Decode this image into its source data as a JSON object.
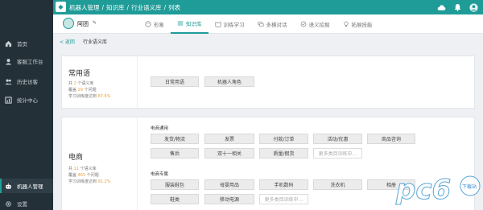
{
  "topbar": {
    "logo_glyph": "◆",
    "breadcrumb": [
      "机器人管理",
      "知识库",
      "行业语义库",
      "列表"
    ]
  },
  "sidebar": {
    "items": [
      {
        "label": "首页",
        "icon": "home-icon"
      },
      {
        "label": "客服工作台",
        "icon": "agent-icon"
      },
      {
        "label": "历史访客",
        "icon": "users-icon"
      },
      {
        "label": "统计中心",
        "icon": "chart-icon"
      },
      {
        "label": "机器人管理",
        "icon": "robot-icon"
      },
      {
        "label": "设置",
        "icon": "gear-icon"
      }
    ]
  },
  "header": {
    "robot_name": "阿团",
    "tabs": [
      {
        "label": "形象",
        "icon": "face-icon"
      },
      {
        "label": "知识库",
        "icon": "book-icon"
      },
      {
        "label": "训练学习",
        "icon": "study-icon"
      },
      {
        "label": "多横对话",
        "icon": "dialog-icon"
      },
      {
        "label": "语义挖掘",
        "icon": "mining-icon"
      },
      {
        "label": "拓展技能",
        "icon": "skill-icon"
      }
    ]
  },
  "backrow": {
    "back_label": "< 返回",
    "title": "行业语义库"
  },
  "card1": {
    "title": "常用语",
    "stat_prefix1": "共",
    "stat_num1": "2",
    "stat_suffix1": "个语义库",
    "stat_prefix2": "覆盖",
    "stat_num2": "29",
    "stat_suffix2": "个问题",
    "stat_prefix3": "学习训练度达到",
    "stat_pct": "87.6%",
    "chips": [
      "日常用语",
      "机器人角色"
    ]
  },
  "card2": {
    "title": "电商",
    "stat_prefix1": "共",
    "stat_num1": "11",
    "stat_suffix1": "个语义库",
    "stat_prefix2": "覆盖",
    "stat_num2": "465",
    "stat_suffix2": "个问题",
    "stat_prefix3": "学习训练度达到",
    "stat_pct": "91.2%",
    "group1_label": "电商通用",
    "group1_chips": [
      "发货/物流",
      "发票",
      "付款/订单",
      "活动/优惠",
      "商品咨询",
      "售后",
      "双十一相关",
      "质量/假货"
    ],
    "group1_placeholder": "更多类目训练中...",
    "group2_label": "电商专属",
    "group2_chips": [
      "服装鞋包",
      "母婴用品",
      "手机数码",
      "洗衣机",
      "相册"
    ],
    "group2_chips_row2": [
      "鞋类",
      "移动电源"
    ],
    "group2_placeholder": "更多类目训练中..."
  },
  "watermark": {
    "text": "pc6",
    "sub": "下载站"
  }
}
